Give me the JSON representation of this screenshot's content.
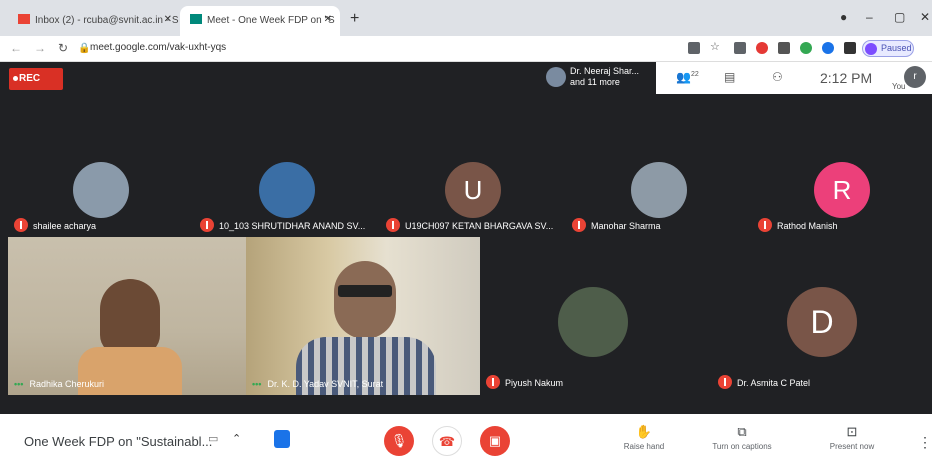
{
  "browser": {
    "tabs": [
      {
        "title": "Inbox (2) - rcuba@svnit.ac.in - S",
        "favicon_color": "#ea4335"
      },
      {
        "title": "Meet - One Week FDP on \"S",
        "favicon_color": "#00897b"
      }
    ],
    "url": "meet.google.com/vak-uxht-yqs",
    "paused_label": "Paused"
  },
  "meet": {
    "rec_label": "REC",
    "presenter": {
      "line1": "Dr. Neeraj Shar...",
      "line2": "and 11 more"
    },
    "people_count": "22",
    "clock": "2:12 PM",
    "you_label": "You",
    "you_initial": "r",
    "tiles_row1": [
      {
        "name": "shailee acharya",
        "avatar_color": "#6b7c8d",
        "muted": true
      },
      {
        "name": "10_103 SHRUTIDHAR ANAND SV...",
        "avatar_color": "#3a6ea5",
        "muted": true
      },
      {
        "name": "U19CH097 KETAN BHARGAVA SV...",
        "initial": "U",
        "avatar_color": "#795548",
        "muted": true
      },
      {
        "name": "Manohar Sharma",
        "avatar_color": "#8d9aa6",
        "muted": true
      },
      {
        "name": "Rathod Manish",
        "initial": "R",
        "avatar_color": "#ec407a",
        "muted": true
      }
    ],
    "tiles_row2": [
      {
        "name": "Radhika Cherukuri",
        "speaking": true
      },
      {
        "name": "Dr. K. D. Yadav SVNIT, Surat",
        "speaking": true
      },
      {
        "name": "Piyush Nakum",
        "avatar_color": "#4e5d4a",
        "muted": true
      },
      {
        "name": "Dr. Asmita C Patel",
        "initial": "D",
        "avatar_color": "#795548",
        "muted": true
      }
    ]
  },
  "bottom": {
    "meeting_title": "One Week FDP on \"Sustainabl...",
    "raise_hand": "Raise hand",
    "captions": "Turn on captions",
    "present": "Present now"
  },
  "colors": {
    "accent_red": "#ea4335",
    "meet_bg": "#202124"
  }
}
